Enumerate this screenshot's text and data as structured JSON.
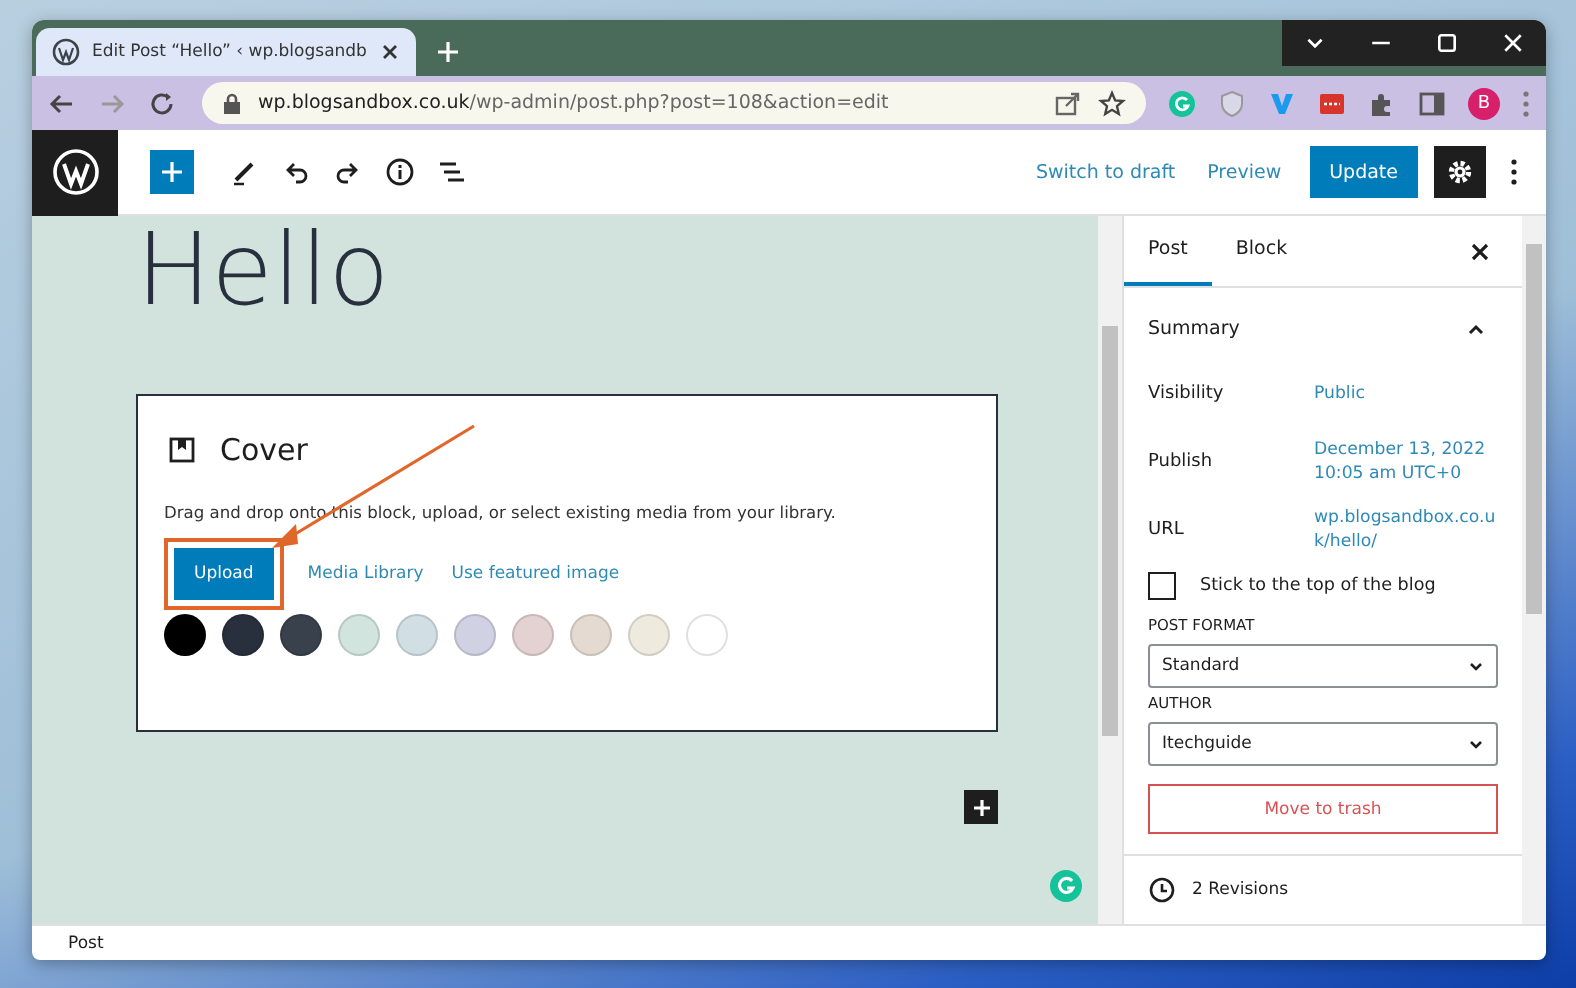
{
  "browser": {
    "tab_title": "Edit Post “Hello” ‹ wp.blogsandb",
    "url_domain": "wp.blogsandbox.co.uk",
    "url_path": "/wp-admin/post.php?post=108&action=edit",
    "profile_initial": "B"
  },
  "toolbar": {
    "actions": [
      {
        "kind": "link",
        "label": "Switch to draft"
      },
      {
        "kind": "link",
        "label": "Preview"
      },
      {
        "kind": "primary",
        "label": "Update"
      }
    ]
  },
  "editor": {
    "heading": "Hello",
    "cover": {
      "title": "Cover",
      "instructions": "Drag and drop onto this block, upload, or select existing media from your library.",
      "buttons": [
        {
          "kind": "primary",
          "label": "Upload",
          "highlighted": true
        },
        {
          "kind": "link",
          "label": "Media Library",
          "highlighted": false
        },
        {
          "kind": "link",
          "label": "Use featured image",
          "highlighted": false
        }
      ],
      "swatches": [
        {
          "color": "#000000"
        },
        {
          "color": "#28303d"
        },
        {
          "color": "#39414d"
        },
        {
          "color": "#d1e4dd"
        },
        {
          "color": "#d1dfe4"
        },
        {
          "color": "#d1d1e4"
        },
        {
          "color": "#e4d1d1"
        },
        {
          "color": "#e4dad1"
        },
        {
          "color": "#eeeadd"
        },
        {
          "color": "#ffffff"
        }
      ]
    }
  },
  "sidebar": {
    "tabs": [
      {
        "label": "Post",
        "selected": true
      },
      {
        "label": "Block",
        "selected": false
      }
    ],
    "summary": {
      "title": "Summary",
      "expanded": true,
      "rows": [
        {
          "label": "Visibility",
          "value": "Public"
        },
        {
          "label": "Publish",
          "value": "December 13, 2022\n10:05 am UTC+0"
        },
        {
          "label": "URL",
          "value": "wp.blogsandbox.co.u\nk/hello/"
        }
      ],
      "sticky": {
        "label": "Stick to the top of the blog",
        "checked": false
      },
      "selects": [
        {
          "label": "POST FORMAT",
          "value": "Standard"
        },
        {
          "label": "AUTHOR",
          "value": "Itechguide"
        }
      ],
      "trash": "Move to trash"
    },
    "revisions": "2 Revisions"
  },
  "status_bar": "Post"
}
